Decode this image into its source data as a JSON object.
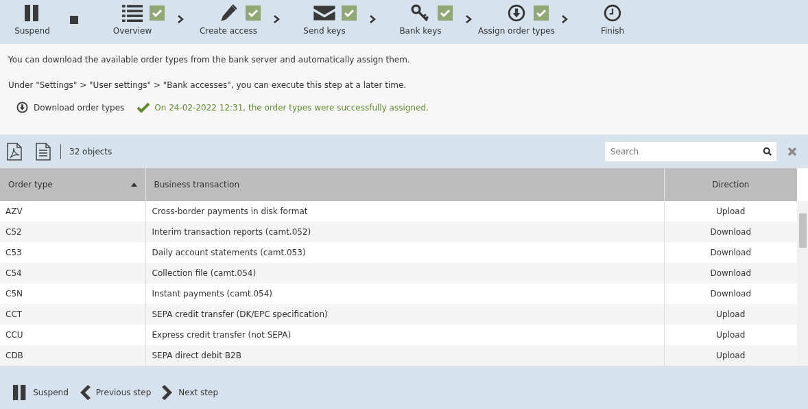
{
  "wizard": {
    "suspend_label": "Suspend",
    "steps": [
      {
        "kind": "list",
        "label": "Overview",
        "done": true
      },
      {
        "kind": "pencil",
        "label": "Create access",
        "done": true
      },
      {
        "kind": "envelope",
        "label": "Send keys",
        "done": true
      },
      {
        "kind": "key",
        "label": "Bank keys",
        "done": true
      },
      {
        "kind": "download",
        "label": "Assign order types",
        "done": true
      },
      {
        "kind": "clock",
        "label": "Finish",
        "done": false
      }
    ]
  },
  "info": {
    "lines": [
      "You can download the available order types from the bank server and automatically assign them.",
      "Under \"Settings\" > \"User settings\" > \"Bank accesses\", you can execute this step at a later time."
    ],
    "download_button": "Download order types",
    "status": "On 24-02-2022 12:31, the order types were successfully assigned."
  },
  "toolbar": {
    "count": "32 objects",
    "search": {
      "placeholder": "Search"
    }
  },
  "table": {
    "columns": [
      {
        "label": "Order type",
        "sorted": true
      },
      {
        "label": "Business transaction",
        "sorted": false
      },
      {
        "label": "Direction",
        "sorted": false
      }
    ],
    "rows": [
      [
        "AZV",
        "Cross-border payments in disk format",
        "Upload"
      ],
      [
        "C52",
        "Interim transaction reports (camt.052)",
        "Download"
      ],
      [
        "C53",
        "Daily account statements (camt.053)",
        "Download"
      ],
      [
        "C54",
        "Collection file (camt.054)",
        "Download"
      ],
      [
        "C5N",
        "Instant payments (camt.054)",
        "Download"
      ],
      [
        "CCT",
        "SEPA credit transfer (DK/EPC specification)",
        "Upload"
      ],
      [
        "CCU",
        "Express credit transfer (not SEPA)",
        "Upload"
      ],
      [
        "CDB",
        "SEPA direct debit B2B",
        "Upload"
      ]
    ]
  },
  "footer": {
    "buttons": [
      {
        "kind": "pause",
        "label": "Suspend"
      },
      {
        "kind": "prev",
        "label": "Previous step"
      },
      {
        "kind": "next",
        "label": "Next step"
      }
    ]
  }
}
